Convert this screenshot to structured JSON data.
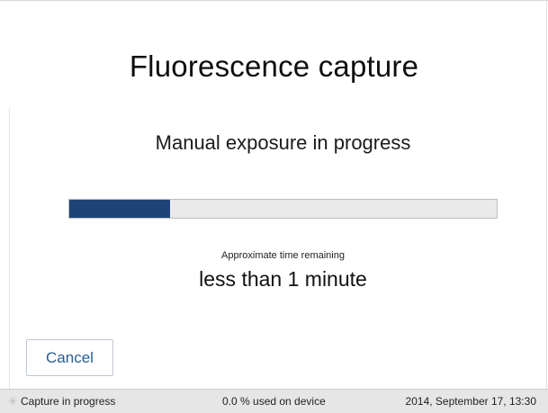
{
  "dialog": {
    "title": "Fluorescence capture",
    "subtitle": "Manual exposure in progress",
    "progress": {
      "value": 0.235,
      "fill_color": "#1e4477",
      "track_color": "#eaeaea"
    },
    "time_remaining_label": "Approximate time remaining",
    "time_remaining_value": "less than 1 minute",
    "cancel_label": "Cancel"
  },
  "status_bar": {
    "activity_icon": "spinner-icon",
    "activity_text": "Capture in progress",
    "storage_text": "0.0 % used on device",
    "datetime_text": "2014, September 17, 13:30"
  },
  "colors": {
    "accent": "#2a5d97",
    "status_bar_bg": "#e6e6e6"
  }
}
